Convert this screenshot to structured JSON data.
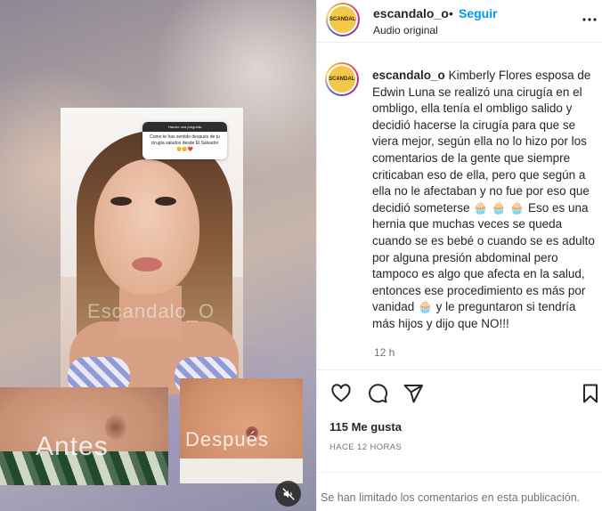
{
  "header": {
    "username": "escandalo_o",
    "separator": "•",
    "follow_label": "Seguir",
    "audio_label": "Audio original",
    "avatar_text": "ESCANDALO"
  },
  "media": {
    "question_header": "Hazme una pregunta",
    "question_text": "Como te has sentido después de tu cirugía saludos desde El Salvador 😊😊❤️",
    "watermark": "Escandalo_O",
    "before_label": "Antes",
    "after_label": "Después"
  },
  "caption": {
    "username": "escandalo_o",
    "text": "Kimberly Flores esposa de Edwin Luna se realizó una cirugía en el ombligo, ella tenía el ombligo salido y decidió hacerse la cirugía para que se viera mejor, según ella no lo hizo por los comentarios de la gente que siempre criticaban eso de ella, pero que según a ella no le afectaban y no fue por eso que decidió someterse 🧁 🧁 🧁  Eso es una hernia que muchas veces se queda cuando se es bebé o cuando se es adulto por alguna presión abdominal pero tampoco es algo que afecta en la salud, entonces ese procedimiento es más por vanidad  🧁  y le preguntaron si tendría más hijos y dijo que NO!!!",
    "time": "12 h"
  },
  "engagement": {
    "likes": "115 Me gusta",
    "posted_ago": "HACE 12 HORAS"
  },
  "comments": {
    "limited_text": "Se han limitado los comentarios en esta publicación."
  },
  "icons": {
    "like": "heart-icon",
    "comment": "comment-icon",
    "share": "send-icon",
    "save": "bookmark-icon",
    "more": "more-icon",
    "mute": "muted-speaker-icon"
  },
  "colors": {
    "accent": "#0095f6",
    "text": "#262626",
    "muted": "#737373"
  }
}
